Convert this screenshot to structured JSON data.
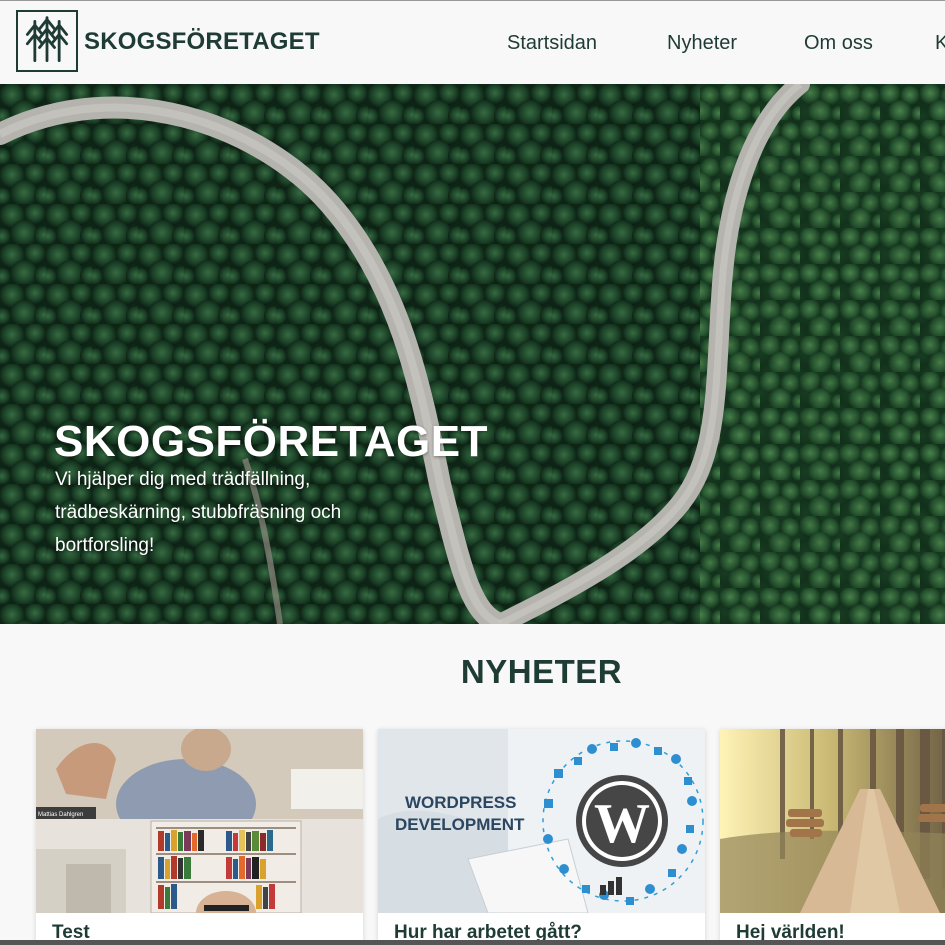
{
  "header": {
    "brand": "SKOGSFÖRETAGET",
    "nav": [
      "Startsidan",
      "Nyheter",
      "Om oss",
      "K"
    ]
  },
  "hero": {
    "title": "SKOGSFÖRETAGET",
    "subtitle": "Vi hjälper dig med trädfällning, trädbeskärning, stubbfräsning och bortforsling!"
  },
  "news": {
    "heading": "NYHETER",
    "cards": [
      {
        "title": "Test",
        "image_text": "Mattias Dahlgren"
      },
      {
        "title": "Hur har arbetet gått?",
        "image_line1": "WORDPRESS",
        "image_line2": "DEVELOPMENT"
      },
      {
        "title": "Hej världen!"
      }
    ]
  },
  "colors": {
    "brand": "#1e3b34",
    "background": "#f8f8f8",
    "hero_text": "#ffffff"
  }
}
